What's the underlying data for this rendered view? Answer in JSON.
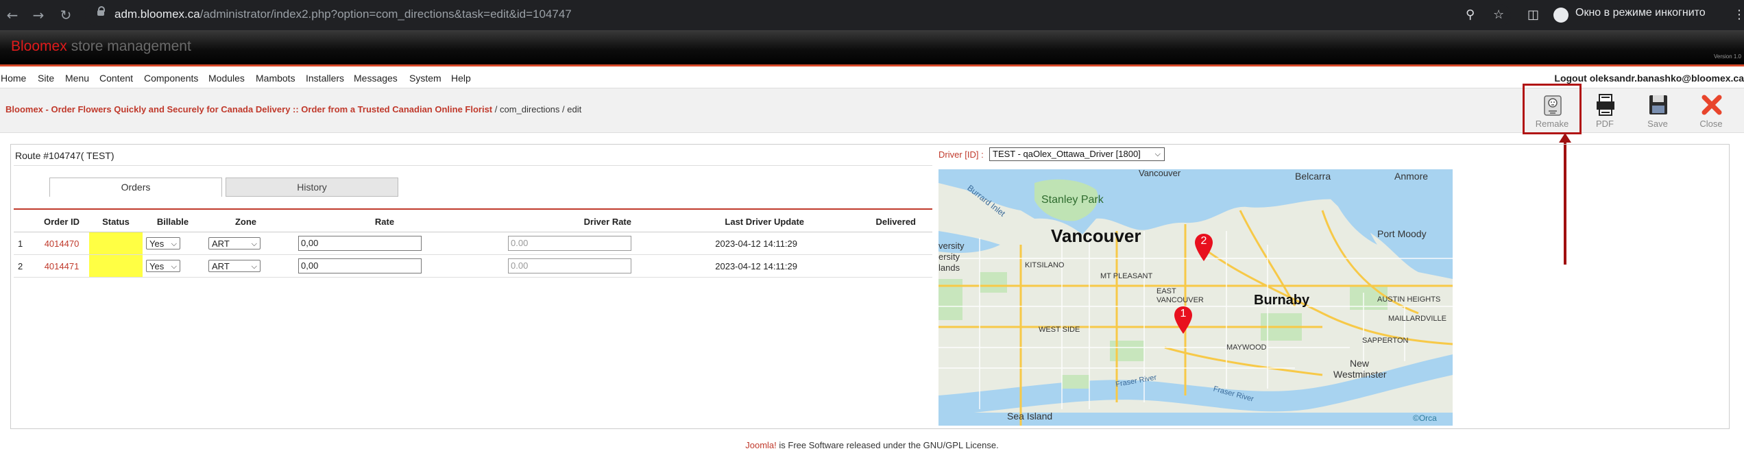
{
  "browser": {
    "url_host": "adm.bloomex.ca",
    "url_path": "/administrator/index2.php?option=com_directions&task=edit&id=104747",
    "incognito_label": "Окно в режиме инкогнито"
  },
  "header": {
    "brand": "Bloomex",
    "subtitle": "store management",
    "version": "Version 1.0"
  },
  "menu": {
    "items": [
      "Home",
      "Site",
      "Menu",
      "Content",
      "Components",
      "Modules",
      "Mambots",
      "Installers",
      "Messages",
      "System",
      "Help"
    ],
    "logout": "Logout oleksandr.banashko@bloomex.ca"
  },
  "breadcrumb": {
    "site": "Bloomex - Order Flowers Quickly and Securely for Canada Delivery :: Order from a Trusted Canadian Online Florist",
    "path": " / com_directions / edit"
  },
  "toolbar": {
    "remake": "Remake",
    "pdf": "PDF",
    "save": "Save",
    "close": "Close"
  },
  "route": {
    "title": "Route #104747( TEST)",
    "tabs": [
      "Orders",
      "History"
    ],
    "columns": [
      "",
      "Order ID",
      "Status",
      "Billable",
      "Zone",
      "Rate",
      "Driver Rate",
      "Last Driver Update",
      "Delivered"
    ],
    "rows": [
      {
        "num": "1",
        "order_id": "4014470",
        "billable": "Yes",
        "zone": "ART",
        "rate": "0,00",
        "driver_rate": "0.00",
        "last_update": "2023-04-12 14:11:29"
      },
      {
        "num": "2",
        "order_id": "4014471",
        "billable": "Yes",
        "zone": "ART",
        "rate": "0,00",
        "driver_rate": "0.00",
        "last_update": "2023-04-12 14:11:29"
      }
    ]
  },
  "driver": {
    "label": "Driver [ID] :",
    "selected": "TEST - qaOlex_Ottawa_Driver [1800]"
  },
  "map": {
    "labels": {
      "vancouver_top": "Vancouver",
      "belcarra": "Belcarra",
      "anmore": "Anmore",
      "burrard": "Burrard Inlet",
      "stanley": "Stanley Park",
      "vancouver": "Vancouver",
      "port_moody": "Port Moody",
      "kitsilano": "KITSILANO",
      "mt_pleasant": "MT PLEASANT",
      "university": "versity",
      "ersity2": "ersity",
      "lands": "lands",
      "east_van": "EAST VANCOUVER",
      "burnaby": "Burnaby",
      "austin": "AUSTIN HEIGHTS",
      "west_side": "WEST SIDE",
      "maillardville": "MAILLARDVILLE",
      "sapperton": "SAPPERTON",
      "maywood": "MAYWOOD",
      "new_west_1": "New",
      "new_west_2": "Westminster",
      "fraser1": "Fraser River",
      "fraser2": "Fraser River",
      "sea_island": "Sea Island",
      "orca": "©Orca"
    },
    "markers": [
      "1",
      "2"
    ]
  },
  "footer": {
    "joomla": "Joomla!",
    "text": " is Free Software released under the GNU/GPL License."
  }
}
